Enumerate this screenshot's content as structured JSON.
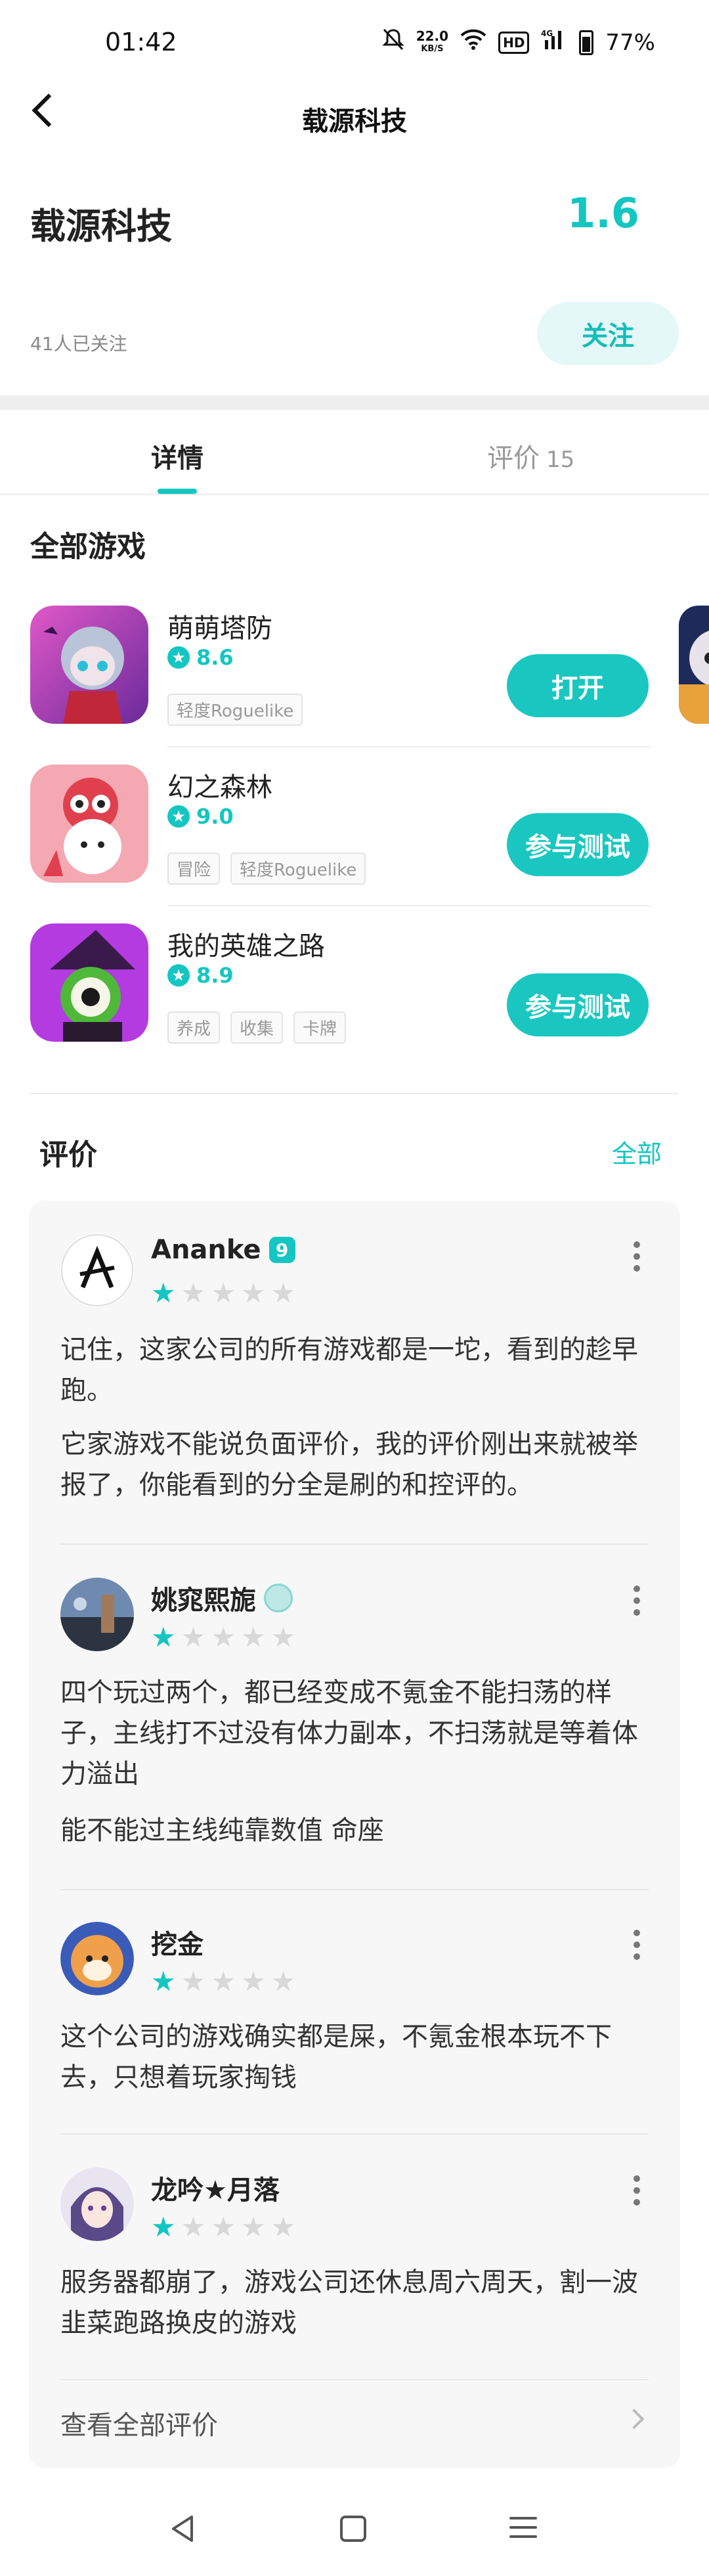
{
  "status": {
    "time": "01:42",
    "speed_top": "22.0",
    "speed_bottom": "KB/S",
    "hd": "HD",
    "network": "4G",
    "battery": "77%"
  },
  "header": {
    "title": "载源科技"
  },
  "company": {
    "name": "载源科技",
    "score": "1.6",
    "followers": "41人已关注",
    "follow_label": "关注"
  },
  "tabs": [
    {
      "label": "详情"
    },
    {
      "label": "评价",
      "count": "15"
    }
  ],
  "games_section": {
    "title": "全部游戏"
  },
  "games": [
    {
      "name": "萌萌塔防",
      "rating": "8.6",
      "tags": [
        "轻度Roguelike"
      ],
      "button": "打开"
    },
    {
      "name": "幻之森林",
      "rating": "9.0",
      "tags": [
        "冒险",
        "轻度Roguelike"
      ],
      "button": "参与测试"
    },
    {
      "name": "我的英雄之路",
      "rating": "8.9",
      "tags": [
        "养成",
        "收集",
        "卡牌"
      ],
      "button": "参与测试"
    }
  ],
  "reviews_section": {
    "title": "评价",
    "all_label": "全部"
  },
  "reviews": [
    {
      "user": "Ananke",
      "badge": "9",
      "stars": 1,
      "paragraphs": [
        "记住，这家公司的所有游戏都是一坨，看到的趁早跑。",
        "它家游戏不能说负面评价，我的评价刚出来就被举报了，你能看到的分全是刷的和控评的。"
      ]
    },
    {
      "user": "姚窕熙旎",
      "stars": 1,
      "paragraphs": [
        "四个玩过两个，都已经变成不氪金不能扫荡的样子，主线打不过没有体力副本，不扫荡就是等着体力溢出",
        "能不能过主线纯靠数值 命座"
      ]
    },
    {
      "user": "挖金",
      "stars": 1,
      "paragraphs": [
        "这个公司的游戏确实都是屎，不氪金根本玩不下去，只想着玩家掏钱"
      ]
    },
    {
      "user": "龙吟★月落",
      "stars": 1,
      "paragraphs": [
        "服务器都崩了，游戏公司还休息周六周天，割一波韭菜跑路换皮的游戏"
      ]
    }
  ],
  "see_all_label": "查看全部评价",
  "colors": {
    "accent": "#13c6c1",
    "follow_bg": "#e4f8f8"
  }
}
